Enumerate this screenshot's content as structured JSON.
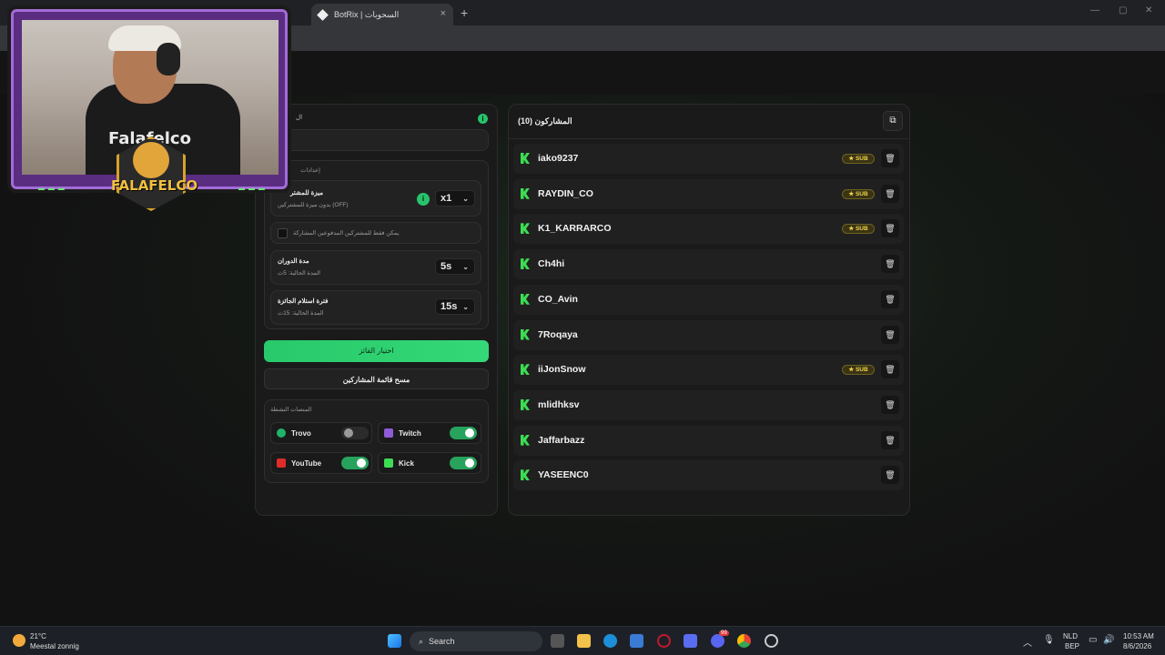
{
  "browser": {
    "tab_title": "BotRix | السحوبات",
    "tab_close": "×",
    "new_tab": "+",
    "win_min": "—",
    "win_max": "▢",
    "win_close": "✕",
    "toolbar_icons": [
      "bookmark-star-icon",
      "instagram-extension-icon",
      "shield-extension-icon",
      "extensions-puzzle-icon",
      "media-controls-icon",
      "profile-icon",
      "menu-dots-icon"
    ]
  },
  "webcam": {
    "shirt_text": "Falafelco",
    "logo_text": "FALAFELCO",
    "deco_left": "▬ ▬ ▬",
    "deco_right": "▬ ▬ ▬"
  },
  "settings": {
    "top_label": "ال",
    "settings_heading": "إعدادات",
    "multiplier_title": "ميزة للمشتر",
    "multiplier_sub": "بدون ميزة للمشتركين (OFF)",
    "multiplier_value": "x1",
    "subs_only_label": "يمكن فقط للمشتركين المدفوعين المشاركة",
    "spin_title": "مدة الدوران",
    "spin_sub": "المدة الحالية: 5ث",
    "spin_value": "5s",
    "claim_title": "فترة استلام الجائزة",
    "claim_sub": "المدة الحالية: 15ث",
    "claim_value": "15s",
    "pick_winner": "اختيار الفائز",
    "clear_list": "مسح قائمة المشاركين",
    "platforms_heading": "المنصات النشطة",
    "platforms": [
      {
        "name": "Trovo",
        "on": false,
        "color": "#1fb36b"
      },
      {
        "name": "Twitch",
        "on": true,
        "color": "#8f5bd6"
      },
      {
        "name": "YouTube",
        "on": true,
        "color": "#e02b2b"
      },
      {
        "name": "Kick",
        "on": true,
        "color": "#3ddc53"
      }
    ]
  },
  "participants": {
    "heading": "المشاركون (10)",
    "sub_badge": "★ SUB",
    "list": [
      {
        "name": "iako9237",
        "sub": true
      },
      {
        "name": "RAYDIN_CO",
        "sub": true
      },
      {
        "name": "K1_KARRARCO",
        "sub": true
      },
      {
        "name": "Ch4hi",
        "sub": false
      },
      {
        "name": "CO_Avin",
        "sub": false
      },
      {
        "name": "7Roqaya",
        "sub": false
      },
      {
        "name": "iiJonSnow",
        "sub": true
      },
      {
        "name": "mlidhksv",
        "sub": false
      },
      {
        "name": "Jaffarbazz",
        "sub": false
      },
      {
        "name": "YASEENC0",
        "sub": false
      }
    ]
  },
  "taskbar": {
    "temp": "21°C",
    "weather": "Meestal zonnig",
    "search": "Search",
    "lang1": "NLD",
    "lang2": "BEP",
    "time": "10:53 AM",
    "date": "8/6/2026",
    "badge_count": "99"
  }
}
